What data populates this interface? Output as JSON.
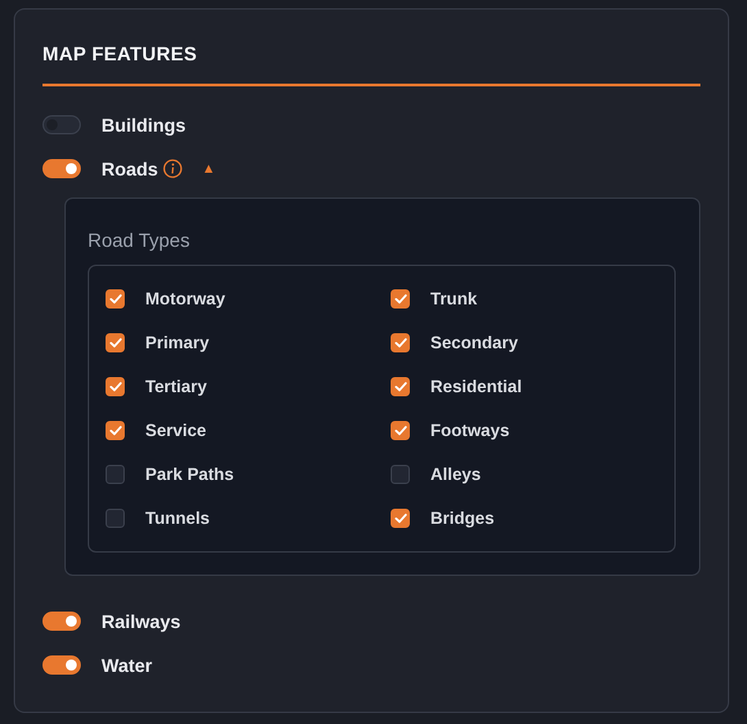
{
  "panel": {
    "title": "MAP FEATURES"
  },
  "features": [
    {
      "label": "Buildings",
      "on": false
    },
    {
      "label": "Roads",
      "on": true,
      "info": true,
      "expanded": true,
      "caret": "▲",
      "sub": {
        "title": "Road Types",
        "options": [
          {
            "label": "Motorway",
            "checked": true
          },
          {
            "label": "Trunk",
            "checked": true
          },
          {
            "label": "Primary",
            "checked": true
          },
          {
            "label": "Secondary",
            "checked": true
          },
          {
            "label": "Tertiary",
            "checked": true
          },
          {
            "label": "Residential",
            "checked": true
          },
          {
            "label": "Service",
            "checked": true
          },
          {
            "label": "Footways",
            "checked": true
          },
          {
            "label": "Park Paths",
            "checked": false
          },
          {
            "label": "Alleys",
            "checked": false
          },
          {
            "label": "Tunnels",
            "checked": false
          },
          {
            "label": "Bridges",
            "checked": true
          }
        ]
      }
    },
    {
      "label": "Railways",
      "on": true
    },
    {
      "label": "Water",
      "on": true
    }
  ]
}
